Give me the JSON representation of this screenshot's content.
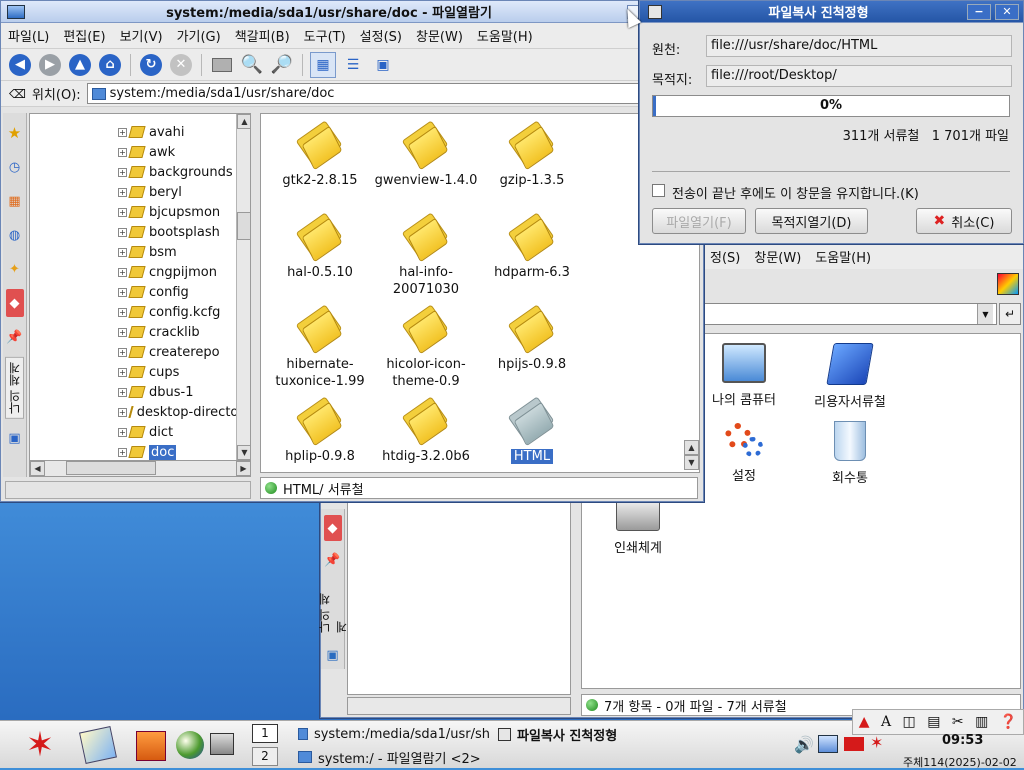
{
  "main_window": {
    "title": "system:/media/sda1/usr/share/doc - 파일열람기",
    "menu": [
      "파일(L)",
      "편집(E)",
      "보기(V)",
      "가기(G)",
      "책갈피(B)",
      "도구(T)",
      "설정(S)",
      "창문(W)",
      "도움말(H)"
    ],
    "location_label": "위치(O):",
    "location_value": "system:/media/sda1/usr/share/doc",
    "sidebar_tab_label": "나의 체계",
    "tree": [
      "avahi",
      "awk",
      "backgrounds",
      "beryl",
      "bjcupsmon",
      "bootsplash",
      "bsm",
      "cngpijmon",
      "config",
      "config.kcfg",
      "cracklib",
      "createrepo",
      "cups",
      "dbus-1",
      "desktop-directorie",
      "dict",
      "doc"
    ],
    "tree_selected": "doc",
    "files": [
      {
        "name": "gtk2-2.8.15"
      },
      {
        "name": "gwenview-1.4.0"
      },
      {
        "name": "gzip-1.3.5"
      },
      {
        "name": "hal-0.5.10"
      },
      {
        "name": "hal-info-20071030"
      },
      {
        "name": "hdparm-6.3"
      },
      {
        "name": "hibernate-tuxonice-1.99"
      },
      {
        "name": "hicolor-icon-theme-0.9"
      },
      {
        "name": "hpijs-0.9.8"
      },
      {
        "name": "hplip-0.9.8"
      },
      {
        "name": "htdig-3.2.0b6"
      },
      {
        "name": "HTML"
      }
    ],
    "status": "HTML/  서류철"
  },
  "copy_dialog": {
    "title": "파일복사 진척정형",
    "source_label": "원천:",
    "source_value": "file:///usr/share/doc/HTML",
    "dest_label": "목적지:",
    "dest_value": "file:///root/Desktop/",
    "progress": 0,
    "progress_text": "0%",
    "summary": "311개 서류철   1 701개 파일",
    "keep_open_label": "전송이 끝난 후에도 이 창문을 유지합니다.(K)",
    "open_file_button": "파일열기(F)",
    "open_dest_button": "목적지열기(D)",
    "cancel_button": "취소(C)"
  },
  "back_window": {
    "menu_partial": [
      "정(S)",
      "창문(W)",
      "도움말(H)"
    ],
    "sidebar_tab_label": "나의 체계",
    "desktop_items": [
      "나의 콤퓨터",
      "리용자서류철",
      "설정",
      "회수통",
      "인쇄체계"
    ],
    "status": "7개 항목 - 0개 파일 - 7개 서류철"
  },
  "taskbar": {
    "desktop_numbers": [
      "1",
      "2"
    ],
    "tasks": [
      "system:/media/sda1/usr/sh",
      "파일복사 진척정형",
      "system:/ - 파일열람기 <2>"
    ],
    "clock": "09:53",
    "date": "주체114(2025)-02-02"
  },
  "colors": {
    "selection": "#3a6ec6",
    "title_active": "#2556a6",
    "desktop": "#3f8fd8"
  }
}
